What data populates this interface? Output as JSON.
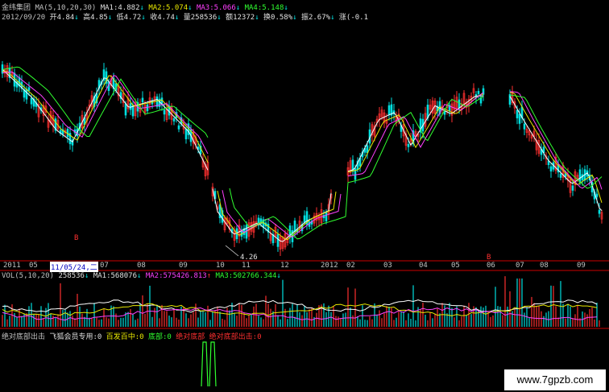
{
  "header": {
    "stock_name": "金纬集团",
    "ma_label": "MA(5,10,20,30)",
    "ma1": "MA1:4.882",
    "ma2": "MA2:5.074",
    "ma3": "MA3:5.066",
    "ma4": "MA4:5.148",
    "date": "2012/09/20",
    "open": "开4.84",
    "high": "高4.85",
    "low": "低4.72",
    "close": "收4.74",
    "volume": "量258536",
    "amount": "额12372",
    "turnover": "换0.58%",
    "amplitude": "振2.67%",
    "change": "涨(-0.1"
  },
  "price_panel": {
    "low_marker": "4.26",
    "signal_markers": [
      "B",
      "B"
    ]
  },
  "date_axis": {
    "labels": [
      "2011",
      "05",
      "11/05/24,二",
      "07",
      "08",
      "09",
      "10",
      "11",
      "12",
      "2012",
      "02",
      "03",
      "04",
      "05",
      "06",
      "07",
      "08",
      "09"
    ],
    "selected_index": 2
  },
  "volume_panel": {
    "label": "VOL(5,10,20)",
    "vol": "258536",
    "ma1": "MA1:568076",
    "ma2": "MA2:575426.813",
    "ma3": "MA3:502766.344"
  },
  "indicator_panel": {
    "name": "绝对底部出击",
    "items": [
      {
        "text": "飞狐会员专用:0",
        "color": "#e0e0e0"
      },
      {
        "text": "百发百中:0",
        "color": "#e8e800"
      },
      {
        "text": "底部:0",
        "color": "#30ff30"
      },
      {
        "text": "绝对底部",
        "color": "#ff3030"
      },
      {
        "text": "绝对底部出击:0",
        "color": "#ff3030"
      }
    ]
  },
  "watermark": "www.7gpzb.com",
  "colors": {
    "up": "#ff3030",
    "down": "#00e0e0",
    "ma1": "#ffffff",
    "ma2": "#e8e800",
    "ma3": "#ff40ff",
    "ma4": "#30ff30",
    "axis": "#cc0000"
  }
}
